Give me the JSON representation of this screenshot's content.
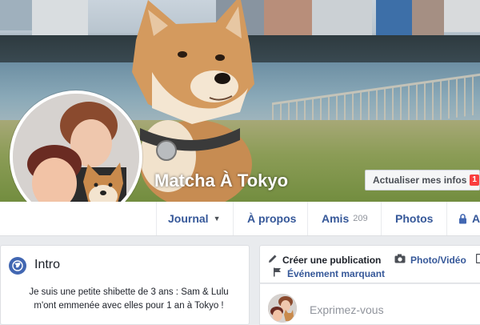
{
  "profile": {
    "name": "Matcha À Tokyo",
    "update_button": "Actualiser mes infos",
    "update_badge": "1"
  },
  "nav": {
    "tabs": [
      {
        "label": "Journal",
        "has_dropdown": true
      },
      {
        "label": "À propos"
      },
      {
        "label": "Amis",
        "count": "209"
      },
      {
        "label": "Photos"
      },
      {
        "label": "A",
        "icon": "lock-icon"
      }
    ]
  },
  "intro": {
    "title": "Intro",
    "icon": "globe-icon",
    "line1": "Je suis une petite shibette de 3 ans : Sam & Lulu",
    "line2": "m'ont emmenée avec elles pour 1 an à Tokyo !"
  },
  "composer": {
    "create_post": "Créer une publication",
    "photo_video": "Photo/Vidéo",
    "life_event": "Événement marquant",
    "placeholder": "Exprimez-vous",
    "icons": [
      "pencil-icon",
      "camera-icon",
      "flag-icon"
    ]
  },
  "colors": {
    "link": "#365899",
    "badge": "#fa3e3e",
    "page_bg": "#e9ebee",
    "accent_blue": "#4267b2"
  }
}
